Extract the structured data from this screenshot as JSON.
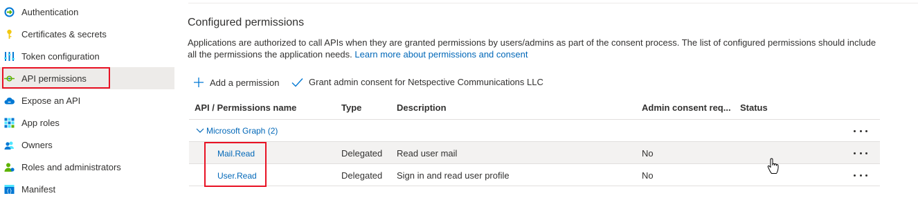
{
  "sidebar": {
    "items": [
      {
        "label": "Authentication",
        "icon": "authentication-icon"
      },
      {
        "label": "Certificates & secrets",
        "icon": "key-icon"
      },
      {
        "label": "Token configuration",
        "icon": "token-config-icon"
      },
      {
        "label": "API permissions",
        "icon": "api-permissions-icon",
        "active": true
      },
      {
        "label": "Expose an API",
        "icon": "cloud-icon"
      },
      {
        "label": "App roles",
        "icon": "app-roles-icon"
      },
      {
        "label": "Owners",
        "icon": "owners-icon"
      },
      {
        "label": "Roles and administrators",
        "icon": "roles-admin-icon"
      },
      {
        "label": "Manifest",
        "icon": "manifest-icon"
      }
    ]
  },
  "main": {
    "title": "Configured permissions",
    "description": "Applications are authorized to call APIs when they are granted permissions by users/admins as part of the consent process. The list of configured permissions should include all the permissions the application needs.",
    "learn_more": "Learn more about permissions and consent",
    "commands": {
      "add": "Add a permission",
      "grant": "Grant admin consent for Netspective Communications LLC"
    },
    "table": {
      "headers": {
        "api": "API / Permissions name",
        "type": "Type",
        "description": "Description",
        "admin": "Admin consent req...",
        "status": "Status"
      },
      "group": "Microsoft Graph (2)",
      "rows": [
        {
          "name": "Mail.Read",
          "type": "Delegated",
          "description": "Read user mail",
          "admin": "No",
          "status": ""
        },
        {
          "name": "User.Read",
          "type": "Delegated",
          "description": "Sign in and read user profile",
          "admin": "No",
          "status": ""
        }
      ]
    }
  },
  "colors": {
    "link": "#0067b8",
    "highlight": "#e81123",
    "active_bg": "#edebe9"
  }
}
